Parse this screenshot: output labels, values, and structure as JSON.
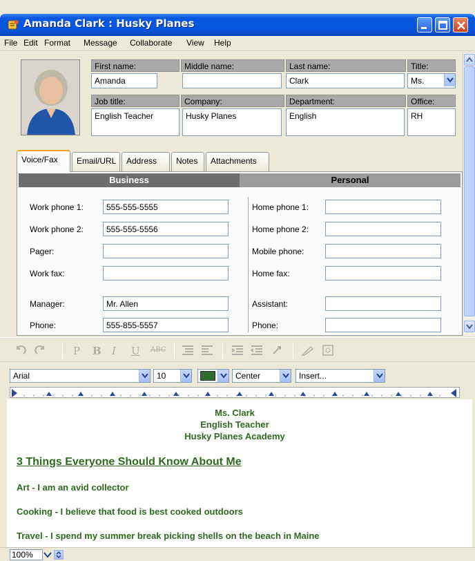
{
  "window": {
    "title": "Amanda Clark : Husky Planes"
  },
  "menu": [
    "File",
    "Edit",
    "Format",
    "Message",
    "Collaborate",
    "View",
    "Help"
  ],
  "contact": {
    "labels": {
      "first_name": "First name:",
      "middle_name": "Middle name:",
      "last_name": "Last name:",
      "title": "Title:",
      "job_title": "Job title:",
      "company": "Company:",
      "department": "Department:",
      "office": "Office:"
    },
    "values": {
      "first_name": "Amanda",
      "middle_name": "",
      "last_name": "Clark",
      "title": "Ms.",
      "job_title": "English Teacher",
      "company": "Husky Planes",
      "department": "English",
      "office": "RH"
    }
  },
  "tabs": [
    "Voice/Fax",
    "Email/URL",
    "Address",
    "Notes",
    "Attachments"
  ],
  "phones": {
    "business_header": "Business",
    "personal_header": "Personal",
    "business": [
      {
        "label": "Work phone 1:",
        "value": "555-555-5555"
      },
      {
        "label": "Work phone 2:",
        "value": "555-555-5556"
      },
      {
        "label": "Pager:",
        "value": ""
      },
      {
        "label": "Work fax:",
        "value": ""
      },
      {
        "label": "Manager:",
        "value": "Mr. Allen"
      },
      {
        "label": "Phone:",
        "value": "555-855-5557"
      }
    ],
    "personal": [
      {
        "label": "Home phone 1:",
        "value": ""
      },
      {
        "label": "Home phone 2:",
        "value": ""
      },
      {
        "label": "Mobile phone:",
        "value": ""
      },
      {
        "label": "Home fax:",
        "value": ""
      },
      {
        "label": "Assistant:",
        "value": ""
      },
      {
        "label": "Phone:",
        "value": ""
      }
    ]
  },
  "format_bar": {
    "font": "Arial",
    "size": "10",
    "align": "Center",
    "insert": "Insert...",
    "text_color": "#2f6b2f"
  },
  "toolbar_glyphs": [
    "P",
    "B",
    "I",
    "U",
    "ABC"
  ],
  "editor": {
    "name": "Ms. Clark",
    "role": "English Teacher",
    "school": "Husky Planes Academy",
    "heading": "3 Things Everyone Should Know About Me",
    "items": [
      "Art - I am an avid collector",
      "Cooking - I believe that food is best cooked outdoors",
      "Travel - I spend my summer break picking shells on the beach in Maine"
    ],
    "text_color": "#2d6a1f"
  },
  "status": {
    "zoom": "100%"
  }
}
